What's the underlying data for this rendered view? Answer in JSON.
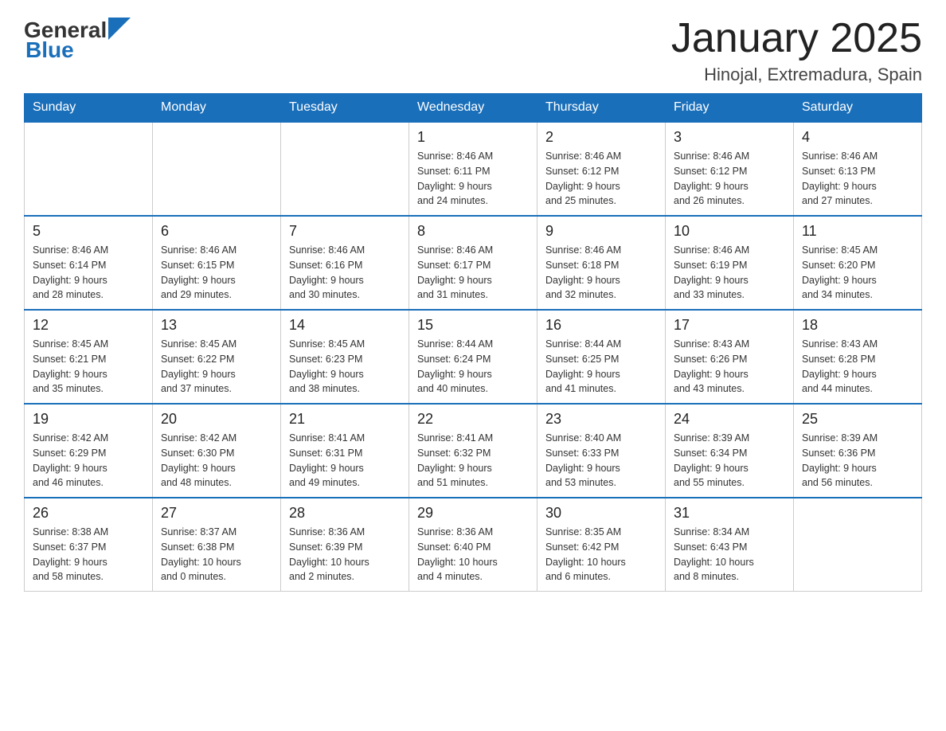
{
  "header": {
    "logo_general": "General",
    "logo_blue": "Blue",
    "title": "January 2025",
    "subtitle": "Hinojal, Extremadura, Spain"
  },
  "weekdays": [
    "Sunday",
    "Monday",
    "Tuesday",
    "Wednesday",
    "Thursday",
    "Friday",
    "Saturday"
  ],
  "weeks": [
    [
      {
        "day": "",
        "info": ""
      },
      {
        "day": "",
        "info": ""
      },
      {
        "day": "",
        "info": ""
      },
      {
        "day": "1",
        "info": "Sunrise: 8:46 AM\nSunset: 6:11 PM\nDaylight: 9 hours\nand 24 minutes."
      },
      {
        "day": "2",
        "info": "Sunrise: 8:46 AM\nSunset: 6:12 PM\nDaylight: 9 hours\nand 25 minutes."
      },
      {
        "day": "3",
        "info": "Sunrise: 8:46 AM\nSunset: 6:12 PM\nDaylight: 9 hours\nand 26 minutes."
      },
      {
        "day": "4",
        "info": "Sunrise: 8:46 AM\nSunset: 6:13 PM\nDaylight: 9 hours\nand 27 minutes."
      }
    ],
    [
      {
        "day": "5",
        "info": "Sunrise: 8:46 AM\nSunset: 6:14 PM\nDaylight: 9 hours\nand 28 minutes."
      },
      {
        "day": "6",
        "info": "Sunrise: 8:46 AM\nSunset: 6:15 PM\nDaylight: 9 hours\nand 29 minutes."
      },
      {
        "day": "7",
        "info": "Sunrise: 8:46 AM\nSunset: 6:16 PM\nDaylight: 9 hours\nand 30 minutes."
      },
      {
        "day": "8",
        "info": "Sunrise: 8:46 AM\nSunset: 6:17 PM\nDaylight: 9 hours\nand 31 minutes."
      },
      {
        "day": "9",
        "info": "Sunrise: 8:46 AM\nSunset: 6:18 PM\nDaylight: 9 hours\nand 32 minutes."
      },
      {
        "day": "10",
        "info": "Sunrise: 8:46 AM\nSunset: 6:19 PM\nDaylight: 9 hours\nand 33 minutes."
      },
      {
        "day": "11",
        "info": "Sunrise: 8:45 AM\nSunset: 6:20 PM\nDaylight: 9 hours\nand 34 minutes."
      }
    ],
    [
      {
        "day": "12",
        "info": "Sunrise: 8:45 AM\nSunset: 6:21 PM\nDaylight: 9 hours\nand 35 minutes."
      },
      {
        "day": "13",
        "info": "Sunrise: 8:45 AM\nSunset: 6:22 PM\nDaylight: 9 hours\nand 37 minutes."
      },
      {
        "day": "14",
        "info": "Sunrise: 8:45 AM\nSunset: 6:23 PM\nDaylight: 9 hours\nand 38 minutes."
      },
      {
        "day": "15",
        "info": "Sunrise: 8:44 AM\nSunset: 6:24 PM\nDaylight: 9 hours\nand 40 minutes."
      },
      {
        "day": "16",
        "info": "Sunrise: 8:44 AM\nSunset: 6:25 PM\nDaylight: 9 hours\nand 41 minutes."
      },
      {
        "day": "17",
        "info": "Sunrise: 8:43 AM\nSunset: 6:26 PM\nDaylight: 9 hours\nand 43 minutes."
      },
      {
        "day": "18",
        "info": "Sunrise: 8:43 AM\nSunset: 6:28 PM\nDaylight: 9 hours\nand 44 minutes."
      }
    ],
    [
      {
        "day": "19",
        "info": "Sunrise: 8:42 AM\nSunset: 6:29 PM\nDaylight: 9 hours\nand 46 minutes."
      },
      {
        "day": "20",
        "info": "Sunrise: 8:42 AM\nSunset: 6:30 PM\nDaylight: 9 hours\nand 48 minutes."
      },
      {
        "day": "21",
        "info": "Sunrise: 8:41 AM\nSunset: 6:31 PM\nDaylight: 9 hours\nand 49 minutes."
      },
      {
        "day": "22",
        "info": "Sunrise: 8:41 AM\nSunset: 6:32 PM\nDaylight: 9 hours\nand 51 minutes."
      },
      {
        "day": "23",
        "info": "Sunrise: 8:40 AM\nSunset: 6:33 PM\nDaylight: 9 hours\nand 53 minutes."
      },
      {
        "day": "24",
        "info": "Sunrise: 8:39 AM\nSunset: 6:34 PM\nDaylight: 9 hours\nand 55 minutes."
      },
      {
        "day": "25",
        "info": "Sunrise: 8:39 AM\nSunset: 6:36 PM\nDaylight: 9 hours\nand 56 minutes."
      }
    ],
    [
      {
        "day": "26",
        "info": "Sunrise: 8:38 AM\nSunset: 6:37 PM\nDaylight: 9 hours\nand 58 minutes."
      },
      {
        "day": "27",
        "info": "Sunrise: 8:37 AM\nSunset: 6:38 PM\nDaylight: 10 hours\nand 0 minutes."
      },
      {
        "day": "28",
        "info": "Sunrise: 8:36 AM\nSunset: 6:39 PM\nDaylight: 10 hours\nand 2 minutes."
      },
      {
        "day": "29",
        "info": "Sunrise: 8:36 AM\nSunset: 6:40 PM\nDaylight: 10 hours\nand 4 minutes."
      },
      {
        "day": "30",
        "info": "Sunrise: 8:35 AM\nSunset: 6:42 PM\nDaylight: 10 hours\nand 6 minutes."
      },
      {
        "day": "31",
        "info": "Sunrise: 8:34 AM\nSunset: 6:43 PM\nDaylight: 10 hours\nand 8 minutes."
      },
      {
        "day": "",
        "info": ""
      }
    ]
  ]
}
